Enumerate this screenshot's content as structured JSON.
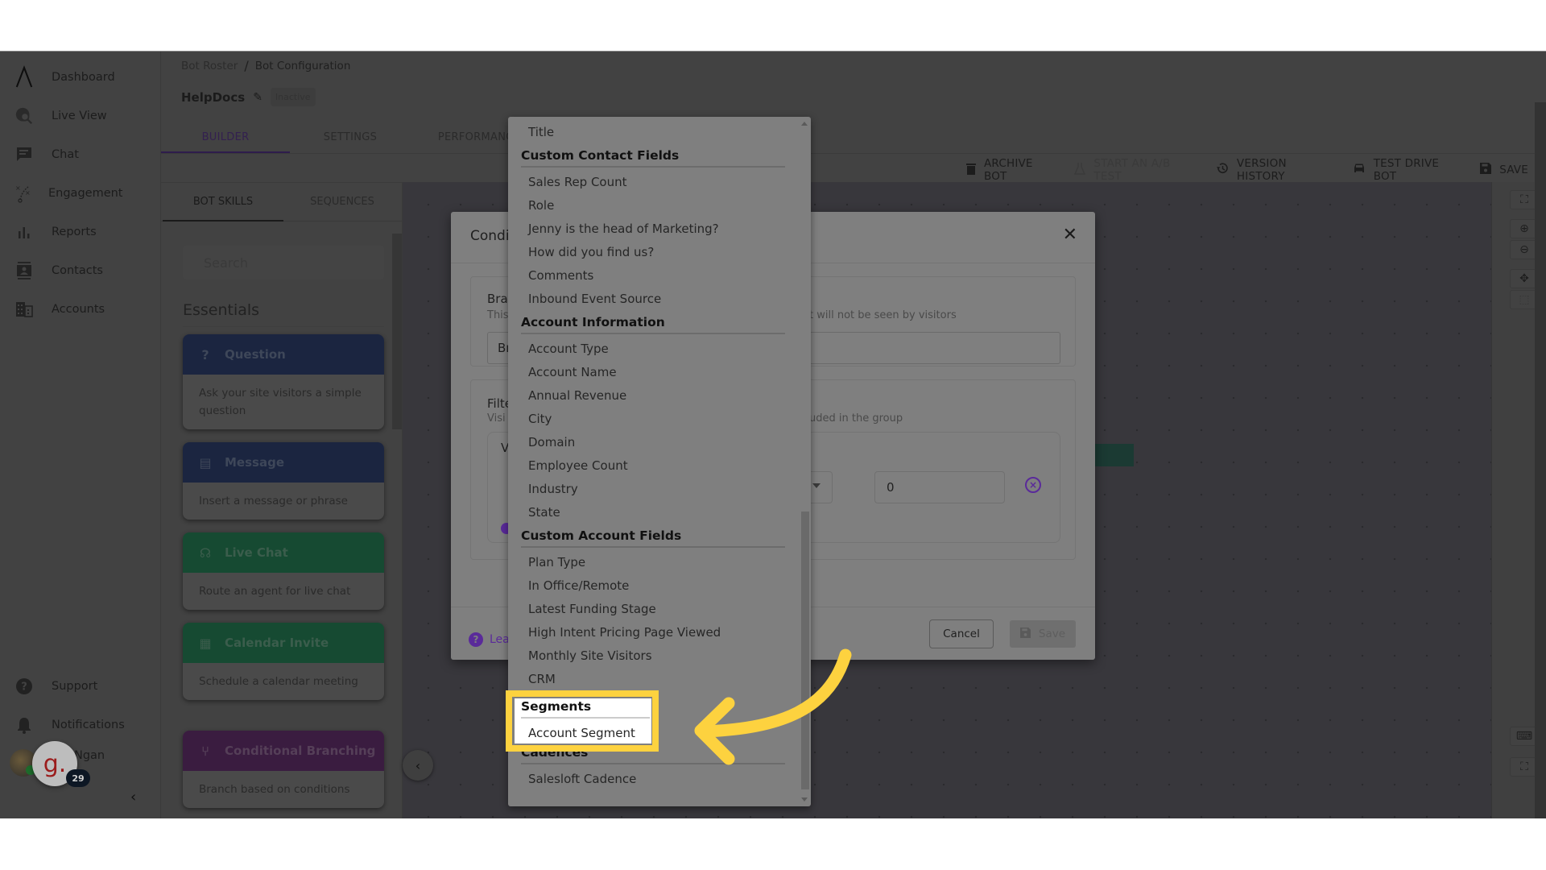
{
  "sidebar": {
    "items": [
      {
        "label": "Dashboard",
        "icon": "logo-caret-icon"
      },
      {
        "label": "Live View",
        "icon": "globe-search-icon"
      },
      {
        "label": "Chat",
        "icon": "chat-icon"
      },
      {
        "label": "Engagement",
        "icon": "play-strategy-icon"
      },
      {
        "label": "Reports",
        "icon": "bar-chart-icon"
      },
      {
        "label": "Contacts",
        "icon": "contact-card-icon"
      },
      {
        "label": "Accounts",
        "icon": "building-icon"
      }
    ],
    "bottom": [
      {
        "label": "Support",
        "icon": "help-circle-icon"
      },
      {
        "label": "Notifications",
        "icon": "bell-icon"
      }
    ],
    "user_name": "Ngan",
    "g_bubble": "g.",
    "g_badge": "29",
    "collapse": "‹"
  },
  "header": {
    "breadcrumb": [
      "Bot Roster",
      "Bot Configuration"
    ],
    "breadcrumb_sep": "/",
    "bot_name": "HelpDocs",
    "status_badge": "Inactive",
    "tabs": [
      "BUILDER",
      "SETTINGS",
      "PERFORMANCE"
    ],
    "active_tab": "BUILDER"
  },
  "toolbar": {
    "archive": "ARCHIVE BOT",
    "ab_test": "START AN A/B TEST",
    "version_history": "VERSION HISTORY",
    "test_drive": "TEST DRIVE BOT",
    "save": "SAVE"
  },
  "panel": {
    "tabs": [
      "BOT SKILLS",
      "SEQUENCES"
    ],
    "search_placeholder": "Search",
    "section": "Essentials",
    "skills": [
      {
        "title": "Question",
        "desc": "Ask your site visitors a simple question",
        "color": "#1b2540"
      },
      {
        "title": "Message",
        "desc": "Insert a message or phrase",
        "color": "#1b2540"
      },
      {
        "title": "Live Chat",
        "desc": "Route an agent for live chat",
        "color": "#164a32"
      },
      {
        "title": "Calendar Invite",
        "desc": "Schedule a calendar meeting",
        "color": "#164a32"
      },
      {
        "title": "Conditional Branching",
        "desc": "Branch based on conditions",
        "color": "#3a1c40"
      }
    ]
  },
  "modal": {
    "title_partial": "Condi",
    "branch_title_partial": "Bra",
    "branch_sub_partial": "This",
    "branch_sub_right": "t will not be seen by visitors",
    "branch_input_partial": "Br",
    "filter_title_partial": "Filte",
    "filter_sub_partial": "Visi",
    "filter_sub_right": "uded in the group",
    "filter_row_partial": "V",
    "value": "0",
    "learn_partial": "Lear",
    "cancel": "Cancel",
    "save": "Save",
    "accent": "#5a2a9a"
  },
  "dropdown": {
    "rows": [
      {
        "type": "item",
        "label": "Title"
      },
      {
        "type": "group",
        "label": "Custom Contact Fields"
      },
      {
        "type": "item",
        "label": "Sales Rep Count"
      },
      {
        "type": "item",
        "label": "Role"
      },
      {
        "type": "item",
        "label": "Jenny is the head of Marketing?"
      },
      {
        "type": "item",
        "label": "How did you find us?"
      },
      {
        "type": "item",
        "label": "Comments"
      },
      {
        "type": "item",
        "label": "Inbound Event Source"
      },
      {
        "type": "group",
        "label": "Account Information"
      },
      {
        "type": "item",
        "label": "Account Type"
      },
      {
        "type": "item",
        "label": "Account Name"
      },
      {
        "type": "item",
        "label": "Annual Revenue"
      },
      {
        "type": "item",
        "label": "City"
      },
      {
        "type": "item",
        "label": "Domain"
      },
      {
        "type": "item",
        "label": "Employee Count"
      },
      {
        "type": "item",
        "label": "Industry"
      },
      {
        "type": "item",
        "label": "State"
      },
      {
        "type": "group",
        "label": "Custom Account Fields"
      },
      {
        "type": "item",
        "label": "Plan Type"
      },
      {
        "type": "item",
        "label": "In Office/Remote"
      },
      {
        "type": "item",
        "label": "Latest Funding Stage"
      },
      {
        "type": "item",
        "label": "High Intent Pricing Page Viewed"
      },
      {
        "type": "item",
        "label": "Monthly Site Visitors"
      },
      {
        "type": "item",
        "label": "CRM"
      },
      {
        "type": "group",
        "label": "Segments",
        "highlight": true
      },
      {
        "type": "item",
        "label": "Account Segment",
        "highlight": true
      },
      {
        "type": "group",
        "label": "Cadences"
      },
      {
        "type": "item",
        "label": "Salesloft Cadence"
      }
    ]
  },
  "callout": {
    "color": "#fdd23f"
  }
}
